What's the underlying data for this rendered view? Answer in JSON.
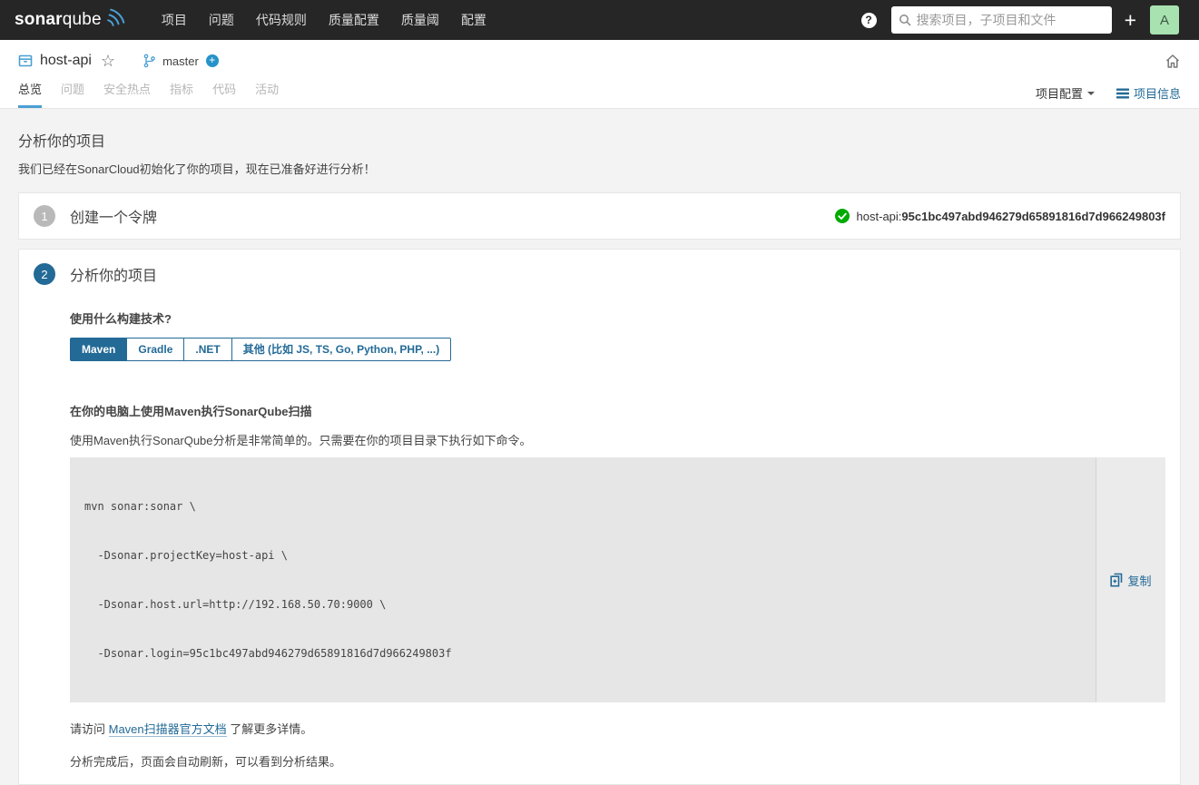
{
  "navbar": {
    "brand_bold": "sonar",
    "brand_light": "qube",
    "menu": [
      "项目",
      "问题",
      "代码规则",
      "质量配置",
      "质量阈",
      "配置"
    ],
    "help_glyph": "?",
    "search_placeholder": "搜索项目，子项目和文件",
    "plus_label": "+",
    "avatar_letter": "A"
  },
  "project_header": {
    "name": "host-api",
    "star_glyph": "☆",
    "branch": "master",
    "branch_plus_glyph": "+"
  },
  "tabs": {
    "items": [
      "总览",
      "问题",
      "安全热点",
      "指标",
      "代码",
      "活动"
    ],
    "active": "总览",
    "project_config_label": "项目配置",
    "project_info_label": "项目信息"
  },
  "main": {
    "title": "分析你的项目",
    "subtitle": "我们已经在SonarCloud初始化了你的项目，现在已准备好进行分析！",
    "step1": {
      "number": "1",
      "title": "创建一个令牌",
      "token_prefix": "host-api:",
      "token_value": "95c1bc497abd946279d65891816d7d966249803f"
    },
    "step2": {
      "number": "2",
      "title": "分析你的项目",
      "build_question": "使用什么构建技术?",
      "build_options": [
        "Maven",
        "Gradle",
        ".NET",
        "其他 (比如 JS, TS, Go, Python, PHP, ...)"
      ],
      "selected_option": "Maven",
      "scan_heading": "在你的电脑上使用Maven执行SonarQube扫描",
      "scan_intro": "使用Maven执行SonarQube分析是非常简单的。只需要在你的项目目录下执行如下命令。",
      "code_lines": [
        "mvn sonar:sonar \\",
        "  -Dsonar.projectKey=host-api \\",
        "  -Dsonar.host.url=http://192.168.50.70:9000 \\",
        "  -Dsonar.login=95c1bc497abd946279d65891816d7d966249803f"
      ],
      "copy_label": "复制",
      "docs_prefix": "请访问 ",
      "docs_link_text": "Maven扫描器官方文档",
      "docs_suffix": " 了解更多详情。",
      "refresh_note": "分析完成后，页面会自动刷新，可以看到分析结果。"
    }
  },
  "colors": {
    "navbar_bg": "#262626",
    "accent_blue": "#236a97",
    "icon_blue": "#4b9fd5",
    "success_green": "#00aa00",
    "avatar_green": "#a8e2b0"
  }
}
